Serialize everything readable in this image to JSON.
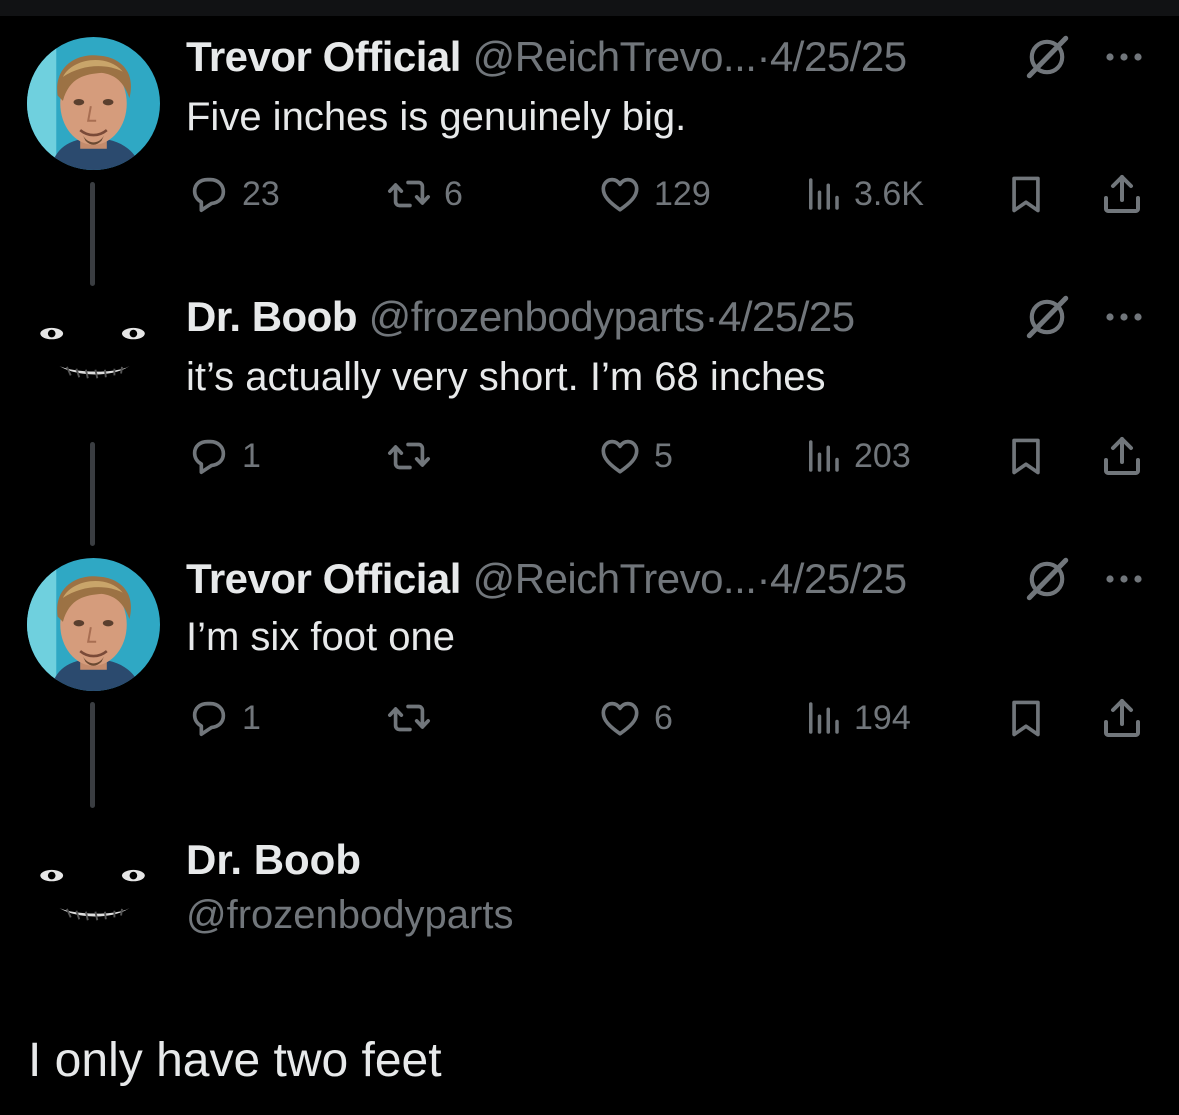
{
  "colors": {
    "background": "#000000",
    "primary_text": "#e7e9ea",
    "secondary_text": "#71767b",
    "thread_line": "#3a3d41"
  },
  "tweets": [
    {
      "display_name": "Trevor Official",
      "handle": "@ReichTrevo...",
      "separator": "·",
      "date": "4/25/25",
      "text": "Five inches is genuinely big.",
      "replies": "23",
      "reposts": "6",
      "likes": "129",
      "views": "3.6K",
      "avatar": "trevor-photo"
    },
    {
      "display_name": "Dr. Boob",
      "handle": "@frozenbodyparts",
      "separator": "·",
      "date": "4/25/25",
      "text": "it’s actually very short. I’m 68 inches",
      "replies": "1",
      "reposts": "",
      "likes": "5",
      "views": "203",
      "avatar": "creepy-face"
    },
    {
      "display_name": "Trevor Official",
      "handle": "@ReichTrevo...",
      "separator": "·",
      "date": "4/25/25",
      "text": "I’m six foot one",
      "replies": "1",
      "reposts": "",
      "likes": "6",
      "views": "194",
      "avatar": "trevor-photo"
    }
  ],
  "final_tweet": {
    "display_name": "Dr. Boob",
    "handle": "@frozenbodyparts",
    "text": "I only have two feet",
    "avatar": "creepy-face"
  },
  "icons": [
    "reply-icon",
    "repost-icon",
    "like-icon",
    "views-icon",
    "bookmark-icon",
    "share-icon",
    "grok-icon",
    "more-icon"
  ]
}
